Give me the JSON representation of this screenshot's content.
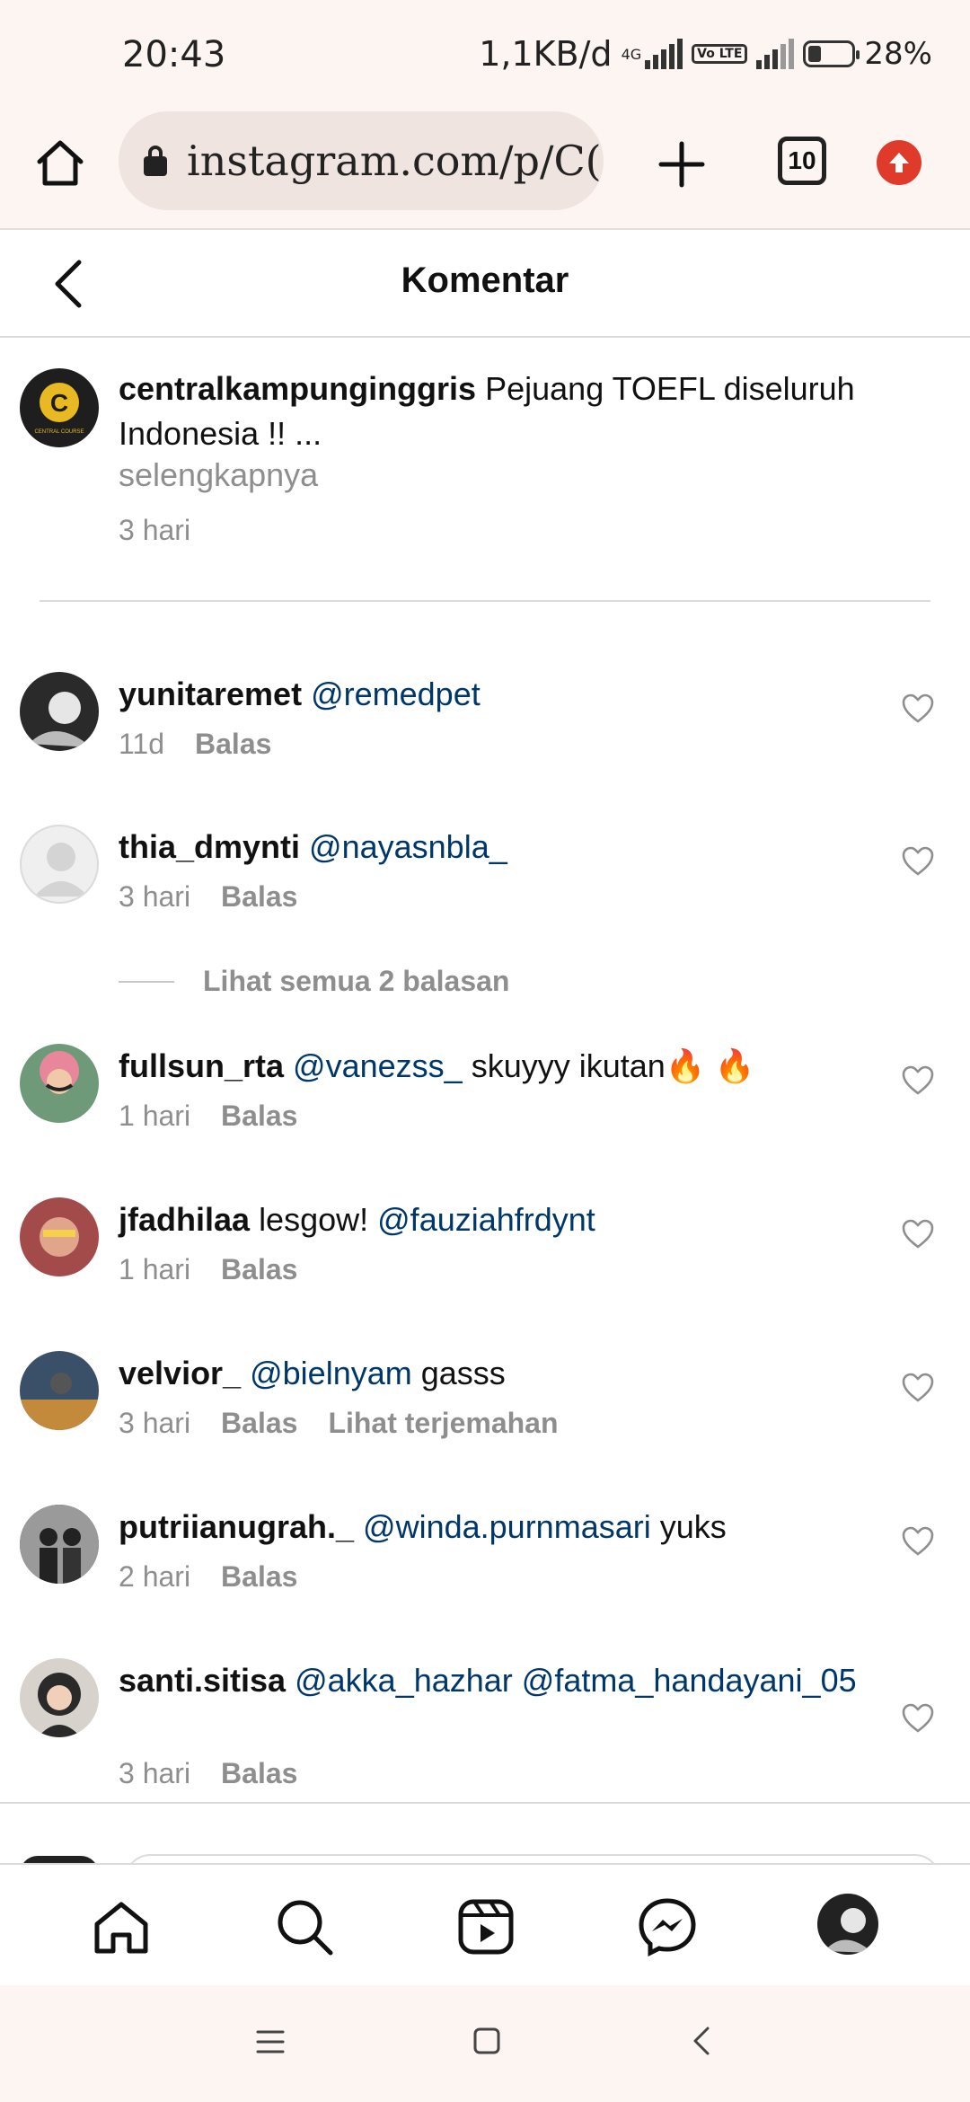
{
  "status_bar": {
    "time": "20:43",
    "speed": "1,1KB/d",
    "network_tag": "4G",
    "volte": "Vo LTE",
    "battery": "28%"
  },
  "browser": {
    "url": "instagram.com/p/C(",
    "tab_count": "10"
  },
  "header": {
    "title": "Komentar"
  },
  "post": {
    "username": "centralkampunginggris",
    "caption": "Pejuang TOEFL diseluruh Indonesia !! ...",
    "more": "selengkapnya",
    "time": "3 hari",
    "logo_letter": "C",
    "logo_text": "CENTRAL COURSE"
  },
  "comments": [
    {
      "username": "yunitaremet",
      "parts": [
        {
          "t": "@remedpet",
          "m": true
        }
      ],
      "time": "11d",
      "reply": "Balas",
      "translate": ""
    },
    {
      "username": "thia_dmynti",
      "parts": [
        {
          "t": "@nayasnbla_",
          "m": true
        }
      ],
      "time": "3 hari",
      "reply": "Balas",
      "translate": ""
    },
    {
      "username": "fullsun_rta",
      "parts": [
        {
          "t": "@vanezss_",
          "m": true
        },
        {
          "t": " skuyyy ikutan🔥 🔥",
          "m": false
        }
      ],
      "time": "1 hari",
      "reply": "Balas",
      "translate": ""
    },
    {
      "username": "jfadhilaa",
      "parts": [
        {
          "t": "lesgow! ",
          "m": false
        },
        {
          "t": "@fauziahfrdynt",
          "m": true
        }
      ],
      "time": "1 hari",
      "reply": "Balas",
      "translate": ""
    },
    {
      "username": "velvior_",
      "parts": [
        {
          "t": "@bielnyam",
          "m": true
        },
        {
          "t": " gasss",
          "m": false
        }
      ],
      "time": "3 hari",
      "reply": "Balas",
      "translate": "Lihat terjemahan"
    },
    {
      "username": "putriianugrah._",
      "parts": [
        {
          "t": "@winda.purnmasari",
          "m": true
        },
        {
          "t": " yuks",
          "m": false
        }
      ],
      "time": "2 hari",
      "reply": "Balas",
      "translate": ""
    },
    {
      "username": "santi.sitisa",
      "parts": [
        {
          "t": "@akka_hazhar",
          "m": true
        },
        {
          "t": " @fatma_handayani_05",
          "m": true
        }
      ],
      "time": "3 hari",
      "reply": "Balas",
      "translate": ""
    }
  ],
  "view_replies": "Lihat semua 2 balasan",
  "colors": {
    "mention": "#00376b",
    "meta": "#8e8e8e",
    "update_badge": "#e03a2b",
    "chrome_bg": "#fdf5f2"
  },
  "icons": {
    "nav": [
      "home-icon",
      "search-icon",
      "reels-icon",
      "messenger-icon",
      "profile-avatar"
    ],
    "system": [
      "menu-icon",
      "square-home-icon",
      "back-chevron-icon"
    ]
  }
}
